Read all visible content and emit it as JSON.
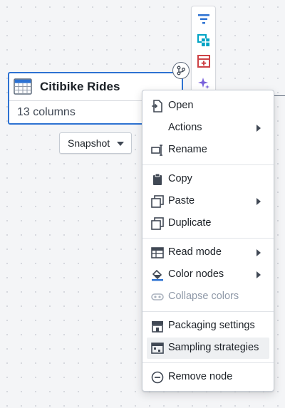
{
  "node": {
    "title": "Citibike Rides",
    "subtitle": "13 columns"
  },
  "snapshot": {
    "label": "Snapshot"
  },
  "toolbar": {
    "icons": [
      "filter-icon",
      "join-table-icon",
      "add-column-icon",
      "ai-sparkle-icon"
    ]
  },
  "menu": {
    "items": [
      {
        "label": "Open",
        "icon": "open-icon",
        "submenu": false
      },
      {
        "label": "Actions",
        "icon": "",
        "submenu": true
      },
      {
        "label": "Rename",
        "icon": "rename-icon",
        "submenu": false
      },
      {
        "label": "Copy",
        "icon": "clipboard-icon",
        "submenu": false
      },
      {
        "label": "Paste",
        "icon": "paste-icon",
        "submenu": true
      },
      {
        "label": "Duplicate",
        "icon": "duplicate-icon",
        "submenu": false
      },
      {
        "label": "Read mode",
        "icon": "table-icon",
        "submenu": true
      },
      {
        "label": "Color nodes",
        "icon": "paint-bucket-icon",
        "submenu": true
      },
      {
        "label": "Collapse colors",
        "icon": "collapse-icon",
        "submenu": false,
        "disabled": true
      },
      {
        "label": "Packaging settings",
        "icon": "shop-icon",
        "submenu": false
      },
      {
        "label": "Sampling strategies",
        "icon": "sampling-icon",
        "submenu": false,
        "hovered": true
      },
      {
        "label": "Remove node",
        "icon": "remove-icon",
        "submenu": false
      }
    ]
  },
  "colors": {
    "accent": "#2d72d2",
    "filter_icon": "#2d72d2",
    "join_icon": "#00a3c4",
    "add_column_icon": "#cd4246",
    "sparkle_icon": "#7961db"
  }
}
